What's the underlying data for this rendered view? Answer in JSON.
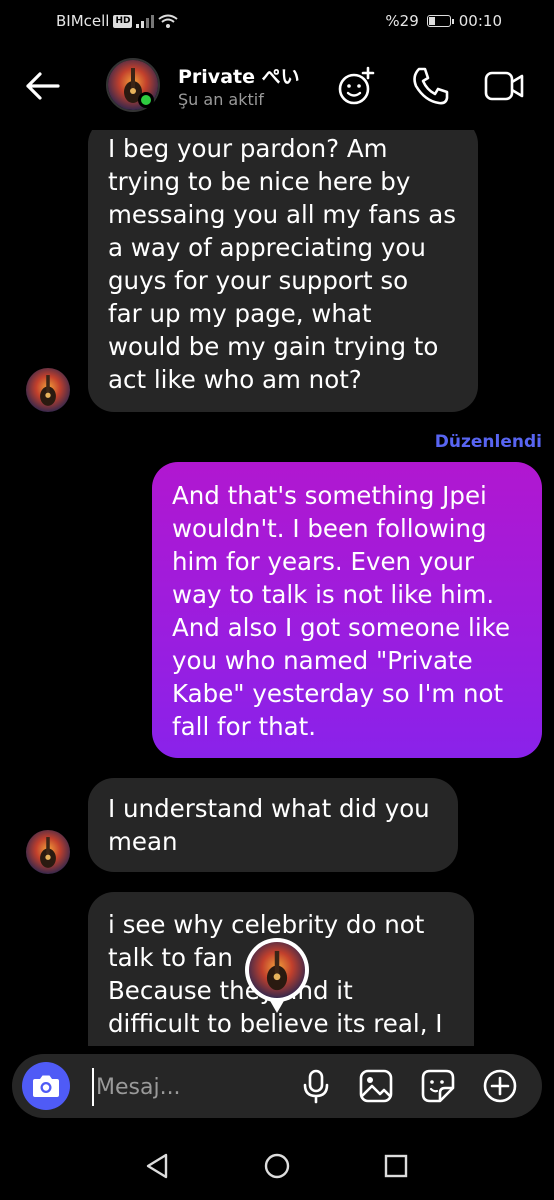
{
  "status_bar": {
    "carrier": "BIMcell",
    "network_badge": "HD",
    "battery_text": "%29",
    "battery_level": 0.29,
    "time": "00:10"
  },
  "header": {
    "contact_name": "Private ぺい",
    "contact_status": "Şu an aktif",
    "icons": [
      "back-arrow-icon",
      "effects-icon",
      "phone-icon",
      "video-icon"
    ]
  },
  "messages": [
    {
      "direction": "incoming",
      "lines": [
        "I beg your pardon? Am",
        "trying to be nice here by",
        "messaing you all my fans as",
        "a way of appreciating you",
        "guys for your support so",
        "far up my page, what",
        "would be my gain trying to",
        "act like who am not?"
      ]
    },
    {
      "direction": "outgoing",
      "edited_label": "Düzenlendi",
      "lines": [
        "And that's something Jpei",
        "wouldn't. I been following",
        "him for years. Even your",
        "way to talk is not like him.",
        "And also I got someone like",
        "you who named \"Private",
        "Kabe\" yesterday so I'm not",
        "fall for that."
      ]
    },
    {
      "direction": "incoming",
      "lines": [
        "I understand what did you",
        "mean"
      ]
    },
    {
      "direction": "incoming",
      "lines": [
        "i see why celebrity do not",
        "talk to fan",
        "Because they find it",
        "difficult to believe its real, I"
      ]
    }
  ],
  "composer": {
    "placeholder": "Mesaj...",
    "icons": [
      "camera-icon",
      "microphone-icon",
      "gallery-icon",
      "sticker-icon",
      "add-icon"
    ]
  },
  "nav_bar": {
    "icons": [
      "nav-back-icon",
      "nav-home-icon",
      "nav-recents-icon"
    ]
  },
  "colors": {
    "accent": "#5865f2",
    "online": "#2ecc40",
    "outgoing_top": "#b117d0",
    "outgoing_bottom": "#8a22ea",
    "incoming_bubble": "#262626"
  }
}
